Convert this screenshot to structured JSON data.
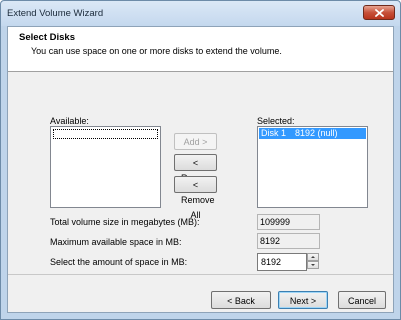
{
  "window": {
    "title": "Extend Volume Wizard"
  },
  "header": {
    "title": "Select Disks",
    "subtitle": "You can use space on one or more disks to extend the volume."
  },
  "available": {
    "label": "Available:"
  },
  "selected": {
    "label": "Selected:",
    "items": [
      {
        "disk": "Disk 1",
        "size": "8192 (null)"
      }
    ]
  },
  "buttons": {
    "add": "Add >",
    "remove": "< Remove",
    "remove_all": "< Remove All",
    "back": "< Back",
    "next": "Next >",
    "cancel": "Cancel"
  },
  "fields": {
    "total_label": "Total volume size in megabytes (MB):",
    "total_value": "109999",
    "max_label": "Maximum available space in MB:",
    "max_value": "8192",
    "amount_label": "Select the amount of space in MB:",
    "amount_value": "8192"
  },
  "icons": {
    "close": "close-icon",
    "spin_up": "chevron-up-icon",
    "spin_down": "chevron-down-icon"
  },
  "colors": {
    "selection": "#3399ff",
    "close_button": "#c7513a"
  }
}
